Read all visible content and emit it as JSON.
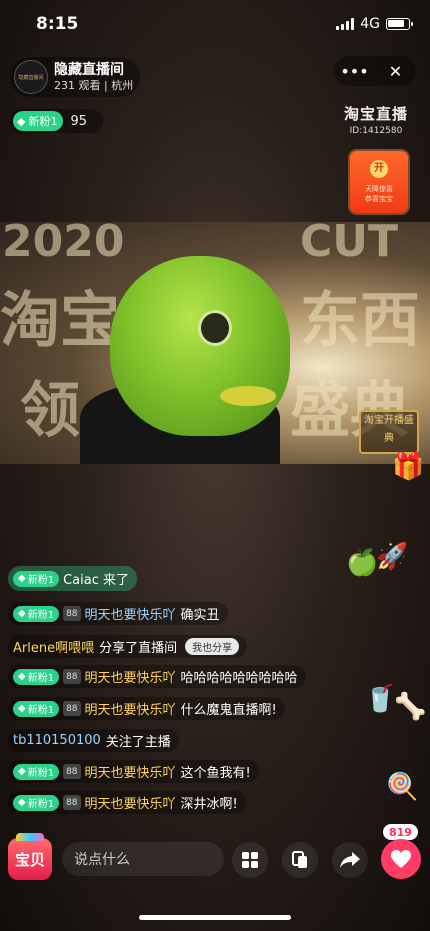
{
  "status_bar": {
    "time": "8:15",
    "network": "4G",
    "battery_level": 0.55
  },
  "host": {
    "name": "隐藏直播间",
    "meta": "231 观看 | 杭州",
    "avatar_label": "隐藏直播间"
  },
  "controls": {
    "more_icon": "more-dots-icon",
    "close_icon": "close-icon"
  },
  "fan_badge": {
    "label": "新粉1",
    "count": "95"
  },
  "brand": {
    "logo": "淘宝直播",
    "id": "ID:1412580"
  },
  "red_packet": {
    "open_label": "开",
    "line1": "天降惊喜",
    "line2": "恭喜宝宝"
  },
  "video": {
    "bg_text": [
      "2020",
      "淘宝",
      "东西",
      "领",
      "盛典",
      "CUT"
    ],
    "stamp": "淘宝开播盛典"
  },
  "messages": [
    {
      "type": "enter",
      "fan": "新粉1",
      "text": "Caiac 来了"
    },
    {
      "type": "chat",
      "fan": "新粉1",
      "level": "88",
      "user": "明天也要快乐吖",
      "text": "确实丑"
    },
    {
      "type": "share",
      "user": "Arlene啊喂喂",
      "text": "分享了直播间",
      "button": "我也分享"
    },
    {
      "type": "chat",
      "fan": "新粉1",
      "level": "88",
      "user": "明天也要快乐吖",
      "text": "哈哈哈哈哈哈哈哈哈"
    },
    {
      "type": "chat",
      "fan": "新粉1",
      "level": "88",
      "user": "明天也要快乐吖",
      "text": "什么魔鬼直播啊!"
    },
    {
      "type": "follow",
      "user": "tb110150100",
      "text": "关注了主播"
    },
    {
      "type": "chat",
      "fan": "新粉1",
      "level": "88",
      "user": "明天也要快乐吖",
      "text": "这个鱼我有!"
    },
    {
      "type": "chat",
      "fan": "新粉1",
      "level": "88",
      "user": "明天也要快乐吖",
      "text": "深井冰啊!"
    }
  ],
  "bottom_bar": {
    "shop_label": "宝贝",
    "chat_placeholder": "说点什么",
    "like_count": "819"
  }
}
